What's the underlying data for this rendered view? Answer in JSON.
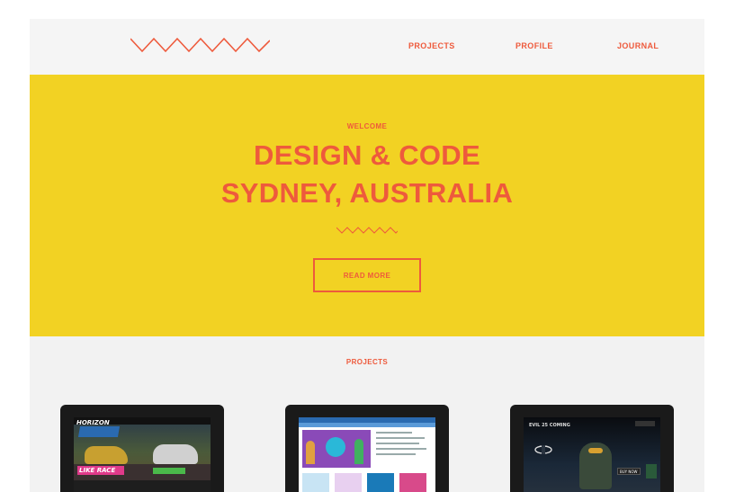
{
  "nav": {
    "projects": "PROJECTS",
    "profile": "PROFILE",
    "journal": "JOURNAL"
  },
  "hero": {
    "welcome": "WELCOME",
    "title_line1": "DESIGN & CODE",
    "title_line2": "SYDNEY, AUSTRALIA",
    "read_more": "READ MORE"
  },
  "projects": {
    "heading": "PROJECTS",
    "thumbnails": [
      {
        "brand": "HORIZON",
        "like_text": "LIKE RACE"
      },
      {},
      {
        "headline": "EVIL 25 COMING",
        "buy_text": "BUY NOW"
      }
    ]
  },
  "colors": {
    "accent": "#ee5a3c",
    "hero_background": "#f2d223",
    "header_background": "#f5f5f5",
    "page_background": "#f2f2f2",
    "device_frame": "#1a1a1a"
  },
  "icons": {
    "logo": "zigzag-logo-icon",
    "hero_divider": "zigzag-divider-icon"
  }
}
